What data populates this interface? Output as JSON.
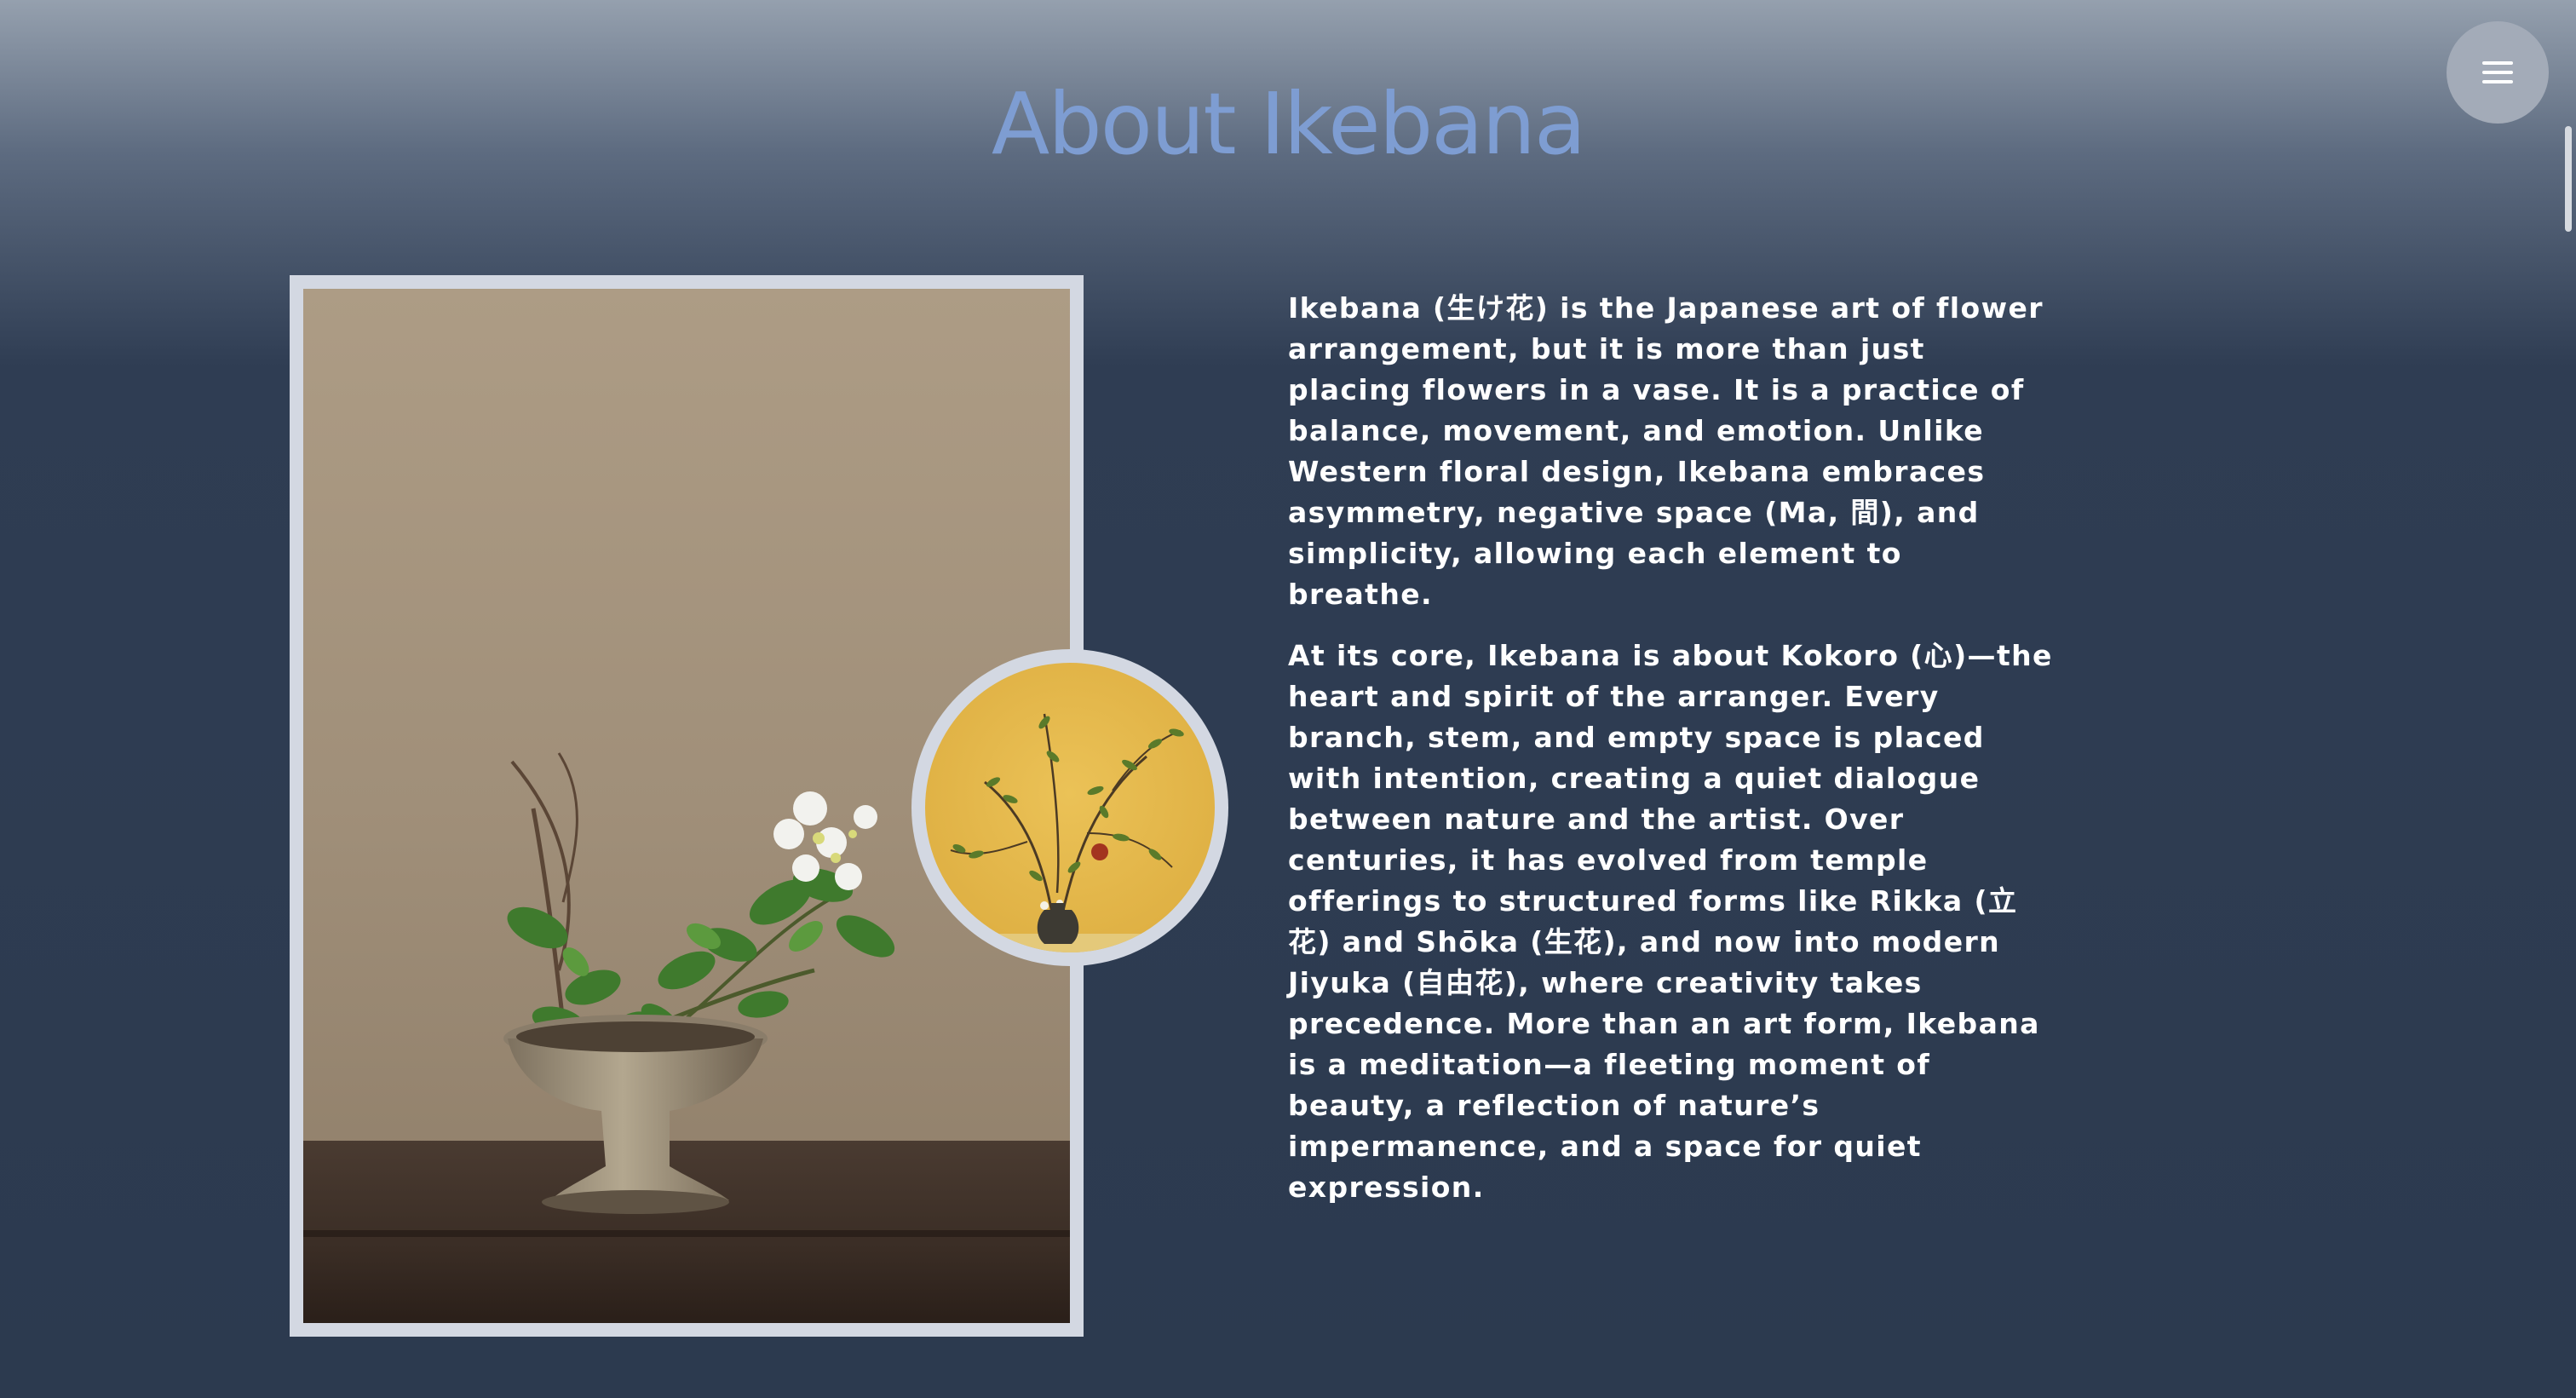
{
  "page": {
    "title": "About Ikebana",
    "menu_icon": "hamburger-menu-icon"
  },
  "about": {
    "paragraphs": [
      "Ikebana (生け花) is the Japanese art of flower arrangement, but it is more than just placing flowers in a vase. It is a practice of balance, movement, and emotion. Unlike Western floral design, Ikebana embraces asymmetry, negative space (Ma, 間), and simplicity, allowing each element to breathe.",
      "At its core, Ikebana is about Kokoro (心)—the heart and spirit of the arranger. Every branch, stem, and empty space is placed with intention, creating a quiet dialogue between nature and the artist. Over centuries, it has evolved from temple offerings to structured forms like Rikka (立花) and Shōka (生花), and now into modern Jiyuka (自由花), where creativity takes precedence. More than an art form, Ikebana is a meditation—a fleeting moment of beauty, a reflection of nature’s impermanence, and a space for quiet expression."
    ],
    "images": {
      "main_photo": "ikebana-arrangement-photo",
      "inset_photo": "ikebana-yellow-background-photo"
    }
  },
  "colors": {
    "title": "#7e9dd2",
    "frame": "#d3d8e2",
    "background_top": "#95a0ae",
    "background_bottom": "#2c3a4f"
  }
}
